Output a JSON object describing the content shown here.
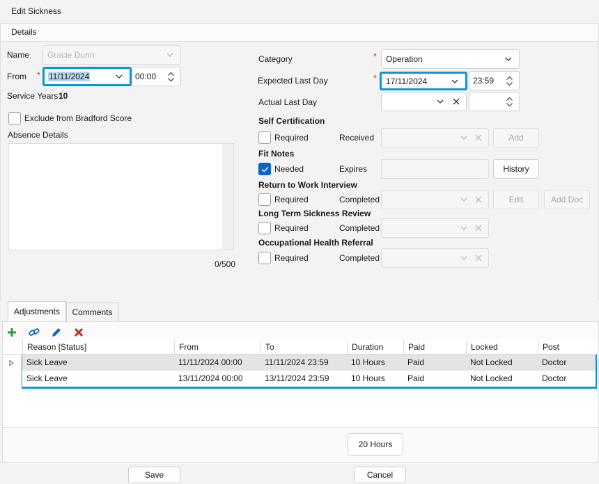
{
  "window": {
    "title": "Edit Sickness"
  },
  "details": {
    "header": "Details",
    "name_label": "Name",
    "name_value": "Gracie Dunn",
    "from_label": "From",
    "from_date": "11/11/2024",
    "from_time": "00:00",
    "service_years_label": "Service Years",
    "service_years_value": "10",
    "exclude_label": "Exclude from Bradford Score",
    "absence_label": "Absence Details",
    "char_count": "0/500",
    "category_label": "Category",
    "category_value": "Operation",
    "expected_label": "Expected Last Day",
    "expected_date": "17/11/2024",
    "expected_time": "23:59",
    "actual_label": "Actual Last Day",
    "actual_date": "",
    "actual_time": ""
  },
  "sections": {
    "self_cert": {
      "title": "Self Certification",
      "check_label": "Required",
      "checked": false,
      "field_label": "Received",
      "button": "Add"
    },
    "fit_notes": {
      "title": "Fit Notes",
      "check_label": "Needed",
      "checked": true,
      "field_label": "Expires",
      "button": "History"
    },
    "rtw": {
      "title": "Return to Work Interview",
      "check_label": "Required",
      "checked": false,
      "field_label": "Completed",
      "button": "Edit",
      "button2": "Add Doc"
    },
    "ltsr": {
      "title": "Long Term Sickness Review",
      "check_label": "Required",
      "checked": false,
      "field_label": "Completed"
    },
    "ohr": {
      "title": "Occupational Health Referral",
      "check_label": "Required",
      "checked": false,
      "field_label": "Completed"
    }
  },
  "tabs": [
    {
      "label": "Adjustments",
      "active": true
    },
    {
      "label": "Comments",
      "active": false
    }
  ],
  "toolbar": {
    "icons": [
      "add-icon",
      "link-icon",
      "edit-icon",
      "delete-icon"
    ]
  },
  "grid": {
    "columns": [
      "Reason [Status]",
      "From",
      "To",
      "Duration",
      "Paid",
      "Locked",
      "Post"
    ],
    "rows": [
      {
        "reason": "Sick Leave",
        "from": "11/11/2024 00:00",
        "to": "11/11/2024 23:59",
        "duration": "10 Hours",
        "paid": "Paid",
        "locked": "Not Locked",
        "post": "Doctor"
      },
      {
        "reason": "Sick Leave",
        "from": "13/11/2024 00:00",
        "to": "13/11/2024 23:59",
        "duration": "10 Hours",
        "paid": "Paid",
        "locked": "Not Locked",
        "post": "Doctor"
      }
    ],
    "total": "20 Hours"
  },
  "footer": {
    "save": "Save",
    "cancel": "Cancel"
  },
  "colors": {
    "accent": "#0a96d8",
    "check": "#0b63c2",
    "required": "#e02020",
    "add": "#2e9b3a",
    "delete": "#d42020",
    "edit": "#1565c0"
  }
}
